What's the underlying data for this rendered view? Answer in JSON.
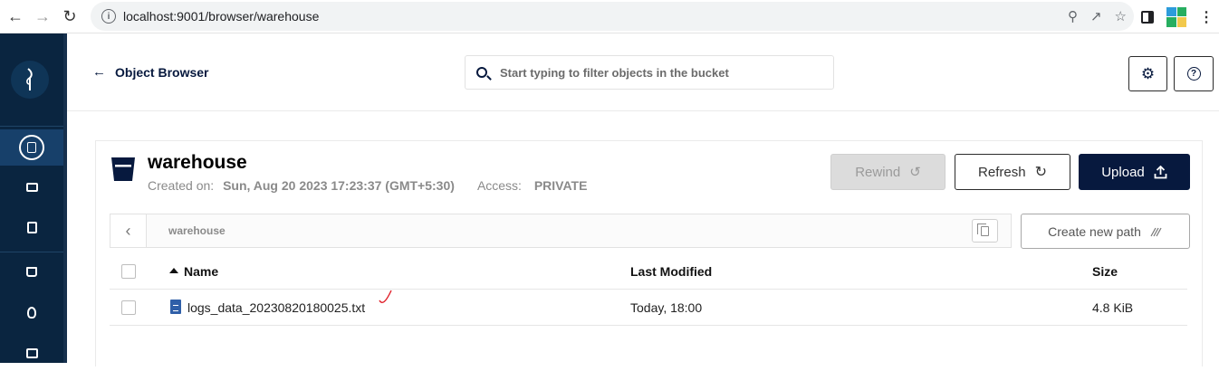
{
  "browser": {
    "url": "localhost:9001/browser/warehouse"
  },
  "header": {
    "back_label": "Object Browser",
    "search_placeholder": "Start typing to filter objects in the bucket"
  },
  "bucket": {
    "name": "warehouse",
    "created_label": "Created on:",
    "created_value": "Sun, Aug 20 2023 17:23:37 (GMT+5:30)",
    "access_label": "Access:",
    "access_value": "PRIVATE"
  },
  "actions": {
    "rewind": "Rewind",
    "refresh": "Refresh",
    "upload": "Upload"
  },
  "path": {
    "breadcrumb": "warehouse",
    "create_new_path": "Create new path"
  },
  "table": {
    "columns": [
      "Name",
      "Last Modified",
      "Size"
    ],
    "rows": [
      {
        "name": "logs_data_20230820180025.txt",
        "last_modified": "Today, 18:00",
        "size": "4.8 KiB"
      }
    ]
  },
  "colors": {
    "brand_dark": "#07193e",
    "sidebar": "#0a2540",
    "file_icon": "#2f5fa8"
  }
}
